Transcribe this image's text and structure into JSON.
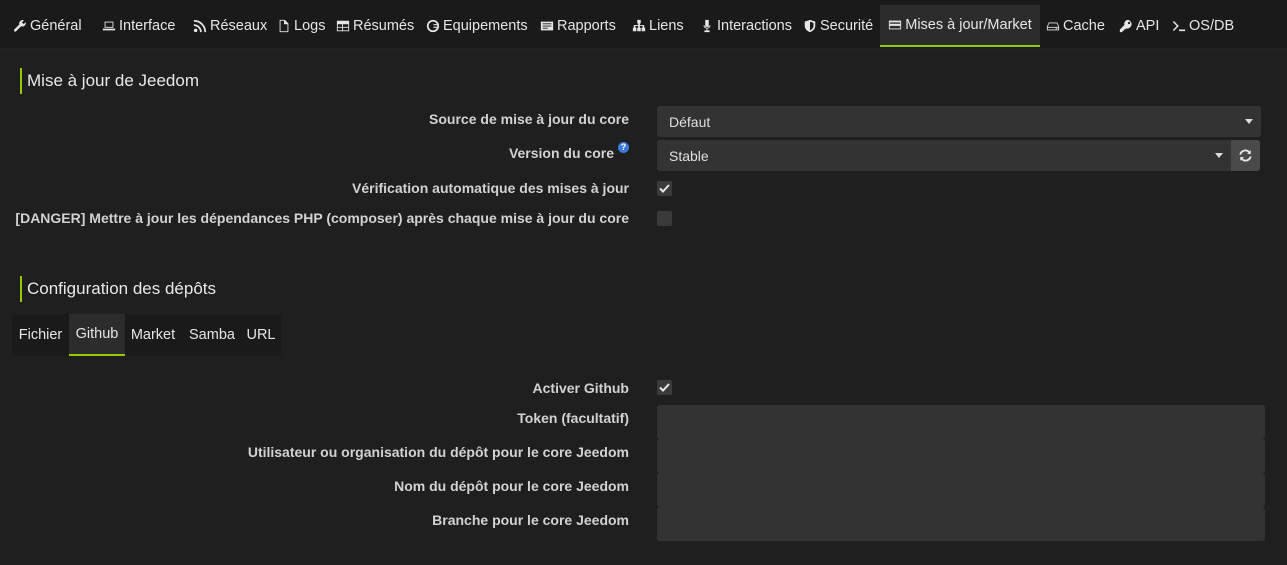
{
  "nav": {
    "tabs": [
      {
        "label": "Général",
        "icon": "wrench-icon"
      },
      {
        "label": "Interface",
        "icon": "laptop-icon"
      },
      {
        "label": "Réseaux",
        "icon": "rss-icon"
      },
      {
        "label": "Logs",
        "icon": "file-icon"
      },
      {
        "label": "Résumés",
        "icon": "table-icon"
      },
      {
        "label": "Equipements",
        "icon": "cube-icon"
      },
      {
        "label": "Rapports",
        "icon": "report-icon"
      },
      {
        "label": "Liens",
        "icon": "sitemap-icon"
      },
      {
        "label": "Interactions",
        "icon": "microphone-icon"
      },
      {
        "label": "Securité",
        "icon": "shield-icon"
      },
      {
        "label": "Mises à jour/Market",
        "icon": "credit-card-icon"
      },
      {
        "label": "Cache",
        "icon": "hdd-icon"
      },
      {
        "label": "API",
        "icon": "key-icon"
      },
      {
        "label": "OS/DB",
        "icon": "terminal-icon"
      }
    ],
    "active": "Mises à jour/Market"
  },
  "update_section": {
    "title": "Mise à jour de Jeedom",
    "source_label": "Source de mise à jour du core",
    "source_value": "Défaut",
    "version_label": "Version du core",
    "version_help": "?",
    "version_value": "Stable",
    "auto_check_label": "Vérification automatique des mises à jour",
    "auto_check_checked": true,
    "danger_label": "[DANGER] Mettre à jour les dépendances PHP (composer) après chaque mise à jour du core",
    "danger_checked": false
  },
  "repo_section": {
    "title": "Configuration des dépôts",
    "tabs": [
      "Fichier",
      "Github",
      "Market",
      "Samba",
      "URL"
    ],
    "active_tab": "Github",
    "enable_label": "Activer Github",
    "enable_checked": true,
    "token_label": "Token (facultatif)",
    "token_value": "",
    "user_label": "Utilisateur ou organisation du dépôt pour le core Jeedom",
    "user_value": "",
    "repo_label": "Nom du dépôt pour le core Jeedom",
    "repo_value": "",
    "branch_label": "Branche pour le core Jeedom",
    "branch_value": ""
  },
  "colors": {
    "accent": "#94ca02",
    "background": "#1f1f1f",
    "input_bg": "#333333"
  }
}
